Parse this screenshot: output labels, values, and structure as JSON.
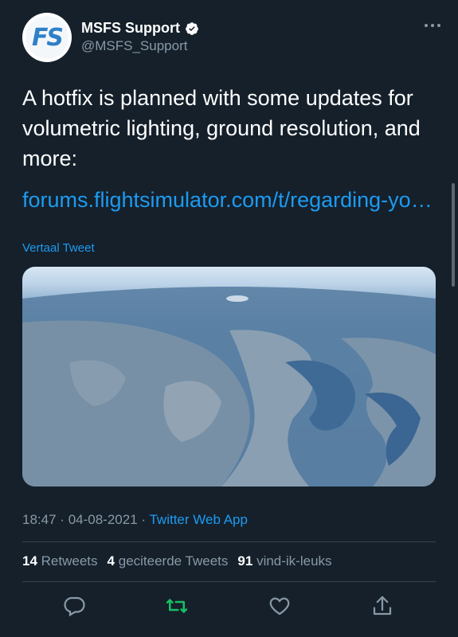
{
  "account": {
    "name": "MSFS Support",
    "handle": "@MSFS_Support",
    "avatar_text": "FS",
    "verified_icon": "verified-badge-icon"
  },
  "tweet": {
    "text": "A hotfix is planned with some updates for volumetric lighting, ground resolution, and more:",
    "link": "forums.flightsimulator.com/t/regarding-yo…",
    "translate_label": "Vertaal Tweet",
    "image_description_icon": "aerial-earth-photo"
  },
  "meta": {
    "time": "18:47",
    "date": "04-08-2021",
    "separator": "·",
    "app": "Twitter Web App"
  },
  "stats": {
    "retweets_count": "14",
    "retweets_label": "Retweets",
    "quotes_count": "4",
    "quotes_label": "geciteerde Tweets",
    "likes_count": "91",
    "likes_label": "vind-ik-leuks"
  },
  "actions": {
    "reply_icon": "reply-icon",
    "retweet_icon": "retweet-icon",
    "like_icon": "heart-icon",
    "share_icon": "share-icon"
  },
  "colors": {
    "background": "#15202b",
    "accent": "#1d9bf0",
    "retweet_green": "#17bf63",
    "secondary_text": "#8899a6"
  }
}
